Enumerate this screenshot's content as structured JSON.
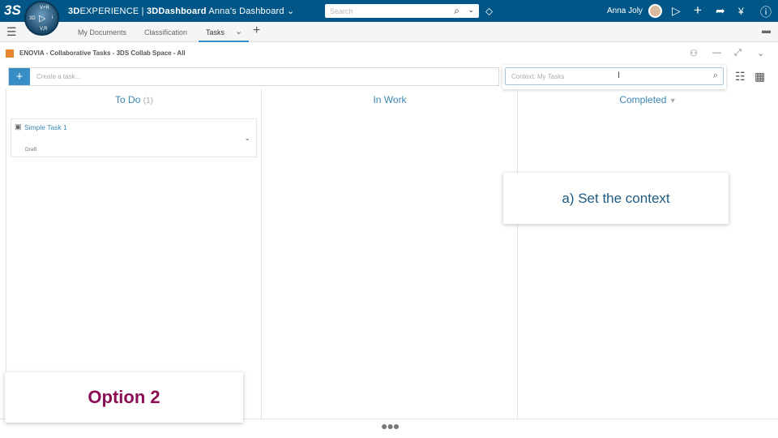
{
  "topbar": {
    "brand_prefix": "3D",
    "brand_main": "EXPERIENCE | ",
    "brand_app": "3DDashboard",
    "dashboard": "Anna's Dashboard",
    "search_placeholder": "Search",
    "user_name": "Anna Joly",
    "compass": {
      "top": "V+R",
      "left": "3D",
      "right": "i",
      "bottom": "V,R"
    }
  },
  "tabs": [
    {
      "label": "My Documents"
    },
    {
      "label": "Classification"
    },
    {
      "label": "Tasks",
      "active": true
    }
  ],
  "widget": {
    "title": "ENOVIA - Collaborative Tasks - 3DS Collab Space - All",
    "create_placeholder": "Create a task...",
    "context_placeholder": "Context: My Tasks"
  },
  "columns": [
    {
      "title": "To Do",
      "count": "(1)"
    },
    {
      "title": "In Work"
    },
    {
      "title": "Completed"
    }
  ],
  "tasks": [
    {
      "name": "Simple Task 1",
      "status": "Draft"
    }
  ],
  "callouts": {
    "step": "a) Set the context",
    "option": "Option 2"
  },
  "colors": {
    "topbar": "#005686",
    "accent": "#368ec4",
    "option": "#8c0f56"
  }
}
